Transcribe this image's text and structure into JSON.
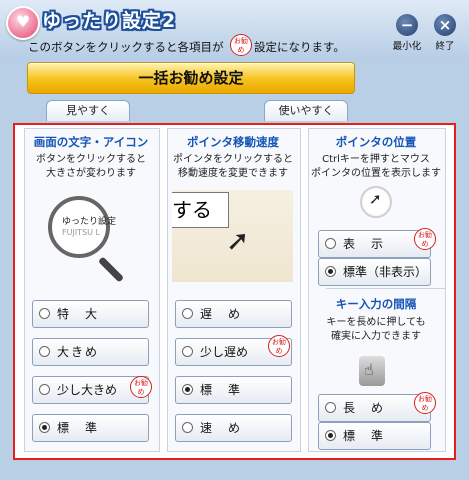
{
  "app": {
    "title": "ゆったり設定2"
  },
  "header": {
    "subtitle_pre": "このボタンをクリックすると各項目が",
    "subtitle_post": "設定になります。",
    "stamp_text": "お勧め",
    "minimize_label": "最小化",
    "close_label": "終了"
  },
  "main": {
    "bulk_button": "一括お勧め設定",
    "tabs": [
      "見やすく",
      "使いやすく"
    ]
  },
  "text_icon": {
    "heading": "画面の文字・アイコン",
    "desc": [
      "ボタンをクリックすると",
      "大きさが変わります"
    ],
    "preview_line1": "ゆったり設定",
    "preview_line2": "FUJITSU L",
    "options": [
      {
        "label": "特　大",
        "selected": false,
        "recommended": false
      },
      {
        "label": "大きめ",
        "selected": false,
        "recommended": false
      },
      {
        "label": "少し大きめ",
        "selected": false,
        "recommended": true
      },
      {
        "label": "標　準",
        "selected": true,
        "recommended": false
      }
    ]
  },
  "pointer_speed": {
    "heading": "ポインタ移動速度",
    "desc": [
      "ポインタをクリックすると",
      "移動速度を変更できます"
    ],
    "preview_text": "する",
    "options": [
      {
        "label": "遅　め",
        "selected": false,
        "recommended": false
      },
      {
        "label": "少し遅め",
        "selected": false,
        "recommended": true
      },
      {
        "label": "標　準",
        "selected": true,
        "recommended": false
      },
      {
        "label": "速　め",
        "selected": false,
        "recommended": false
      }
    ]
  },
  "pointer_position": {
    "heading": "ポインタの位置",
    "desc": [
      "Ctrlキーを押すとマウス",
      "ポインタの位置を表示します"
    ],
    "options": [
      {
        "label": "表　示",
        "selected": false,
        "recommended": true
      },
      {
        "label": "標準（非表示）",
        "selected": true,
        "recommended": false
      }
    ]
  },
  "key_interval": {
    "heading": "キー入力の間隔",
    "desc": [
      "キーを長めに押しても",
      "確実に入力できます"
    ],
    "options": [
      {
        "label": "長　め",
        "selected": false,
        "recommended": true
      },
      {
        "label": "標　準",
        "selected": true,
        "recommended": false
      }
    ]
  }
}
